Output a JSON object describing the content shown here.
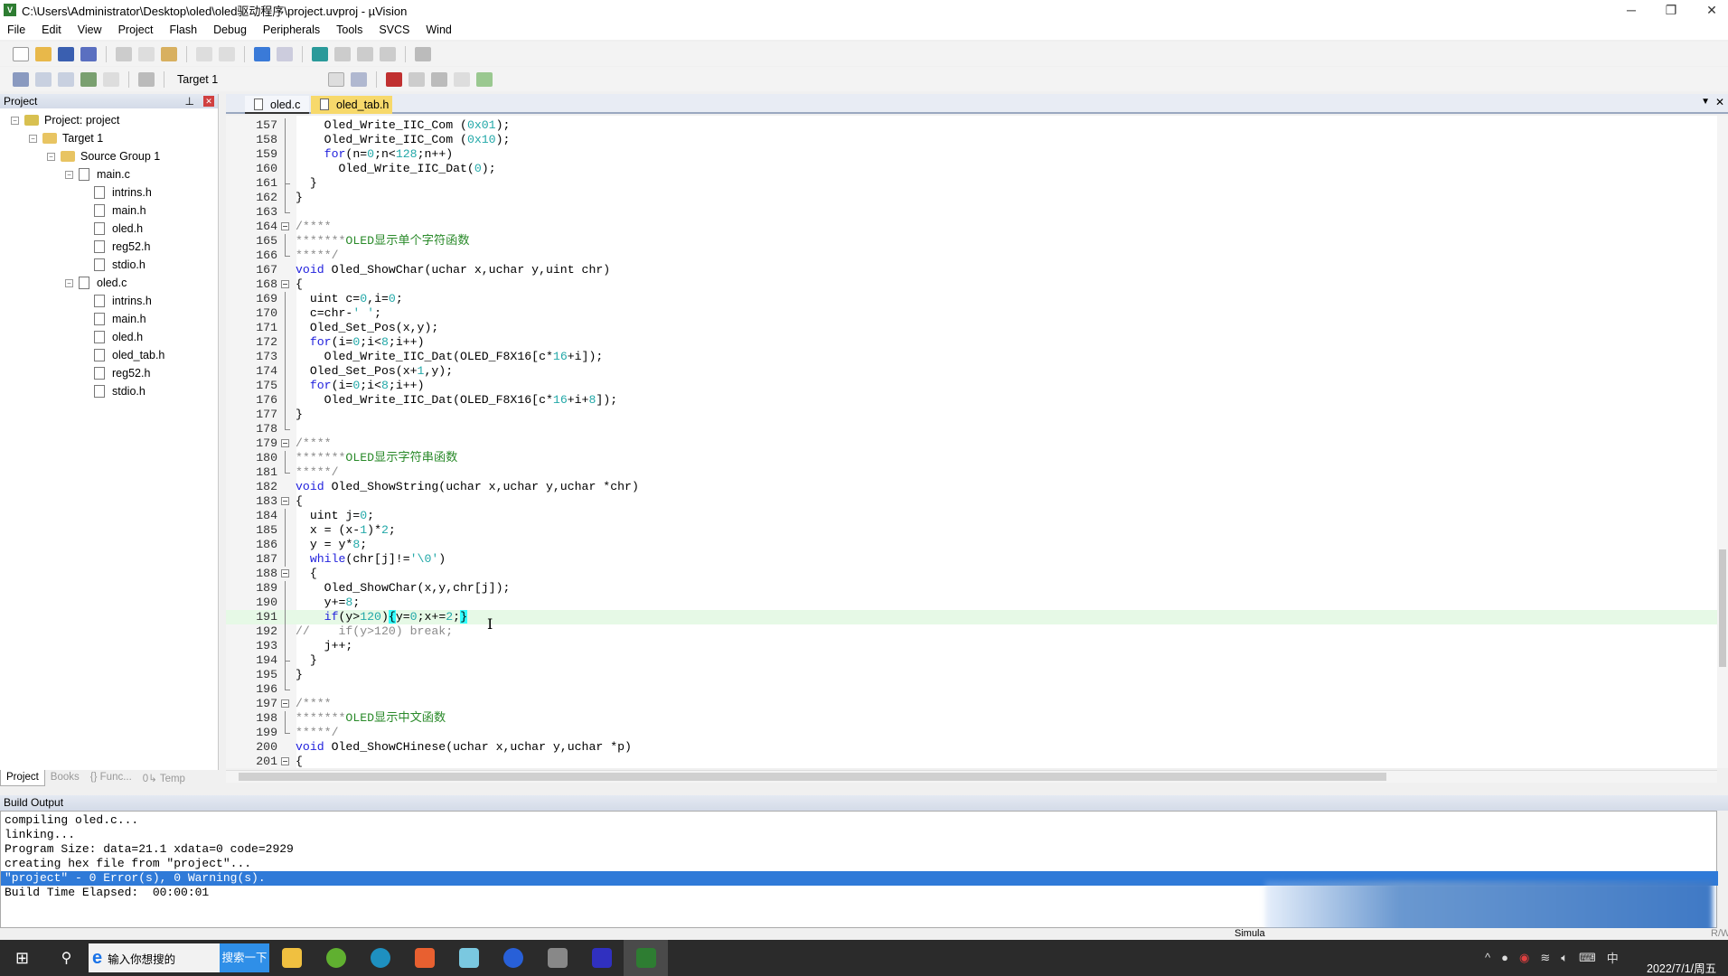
{
  "window": {
    "title": "C:\\Users\\Administrator\\Desktop\\oled\\oled驱动程序\\project.uvproj - µVision",
    "minimize": "─",
    "restore": "❐",
    "close": "✕"
  },
  "menu": [
    "File",
    "Edit",
    "View",
    "Project",
    "Flash",
    "Debug",
    "Peripherals",
    "Tools",
    "SVCS",
    "Wind"
  ],
  "toolbar": {
    "target": "Target 1"
  },
  "project_panel": {
    "title": "Project",
    "tree": [
      {
        "label": "Project: project",
        "level": 0,
        "kind": "project",
        "expanded": true
      },
      {
        "label": "Target 1",
        "level": 1,
        "kind": "target",
        "expanded": true
      },
      {
        "label": "Source Group 1",
        "level": 2,
        "kind": "folder",
        "expanded": true
      },
      {
        "label": "main.c",
        "level": 3,
        "kind": "source",
        "expanded": true
      },
      {
        "label": "intrins.h",
        "level": 4,
        "kind": "file"
      },
      {
        "label": "main.h",
        "level": 4,
        "kind": "file"
      },
      {
        "label": "oled.h",
        "level": 4,
        "kind": "file"
      },
      {
        "label": "reg52.h",
        "level": 4,
        "kind": "file"
      },
      {
        "label": "stdio.h",
        "level": 4,
        "kind": "file"
      },
      {
        "label": "oled.c",
        "level": 3,
        "kind": "source",
        "expanded": true
      },
      {
        "label": "intrins.h",
        "level": 4,
        "kind": "file"
      },
      {
        "label": "main.h",
        "level": 4,
        "kind": "file"
      },
      {
        "label": "oled.h",
        "level": 4,
        "kind": "file"
      },
      {
        "label": "oled_tab.h",
        "level": 4,
        "kind": "file"
      },
      {
        "label": "reg52.h",
        "level": 4,
        "kind": "file"
      },
      {
        "label": "stdio.h",
        "level": 4,
        "kind": "file"
      }
    ],
    "bottom_tabs": [
      {
        "label": "Project",
        "active": true
      },
      {
        "label": "Books"
      },
      {
        "label": "{} Func..."
      },
      {
        "label": "0↳ Temp"
      }
    ]
  },
  "editor": {
    "tabs": [
      {
        "label": "oled.c",
        "active": true
      },
      {
        "label": "oled_tab.h",
        "active": false
      }
    ],
    "lines": [
      {
        "n": 157,
        "text": "    Oled_Write_IIC_Com (0x01);",
        "fold": "line"
      },
      {
        "n": 158,
        "text": "    Oled_Write_IIC_Com (0x10);",
        "fold": "line"
      },
      {
        "n": 159,
        "text": "    for(n=0;n<128;n++)",
        "fold": "line"
      },
      {
        "n": 160,
        "text": "      Oled_Write_IIC_Dat(0);",
        "fold": "line"
      },
      {
        "n": 161,
        "text": "  }",
        "fold": "mid"
      },
      {
        "n": 162,
        "text": "}",
        "fold": "line"
      },
      {
        "n": 163,
        "text": "",
        "fold": "end"
      },
      {
        "n": 164,
        "text": "/****",
        "fold": "open"
      },
      {
        "n": 165,
        "text": "*******OLED显示单个字符函数",
        "fold": "line"
      },
      {
        "n": 166,
        "text": "*****/",
        "fold": "end"
      },
      {
        "n": 167,
        "text": "void Oled_ShowChar(uchar x,uchar y,uint chr)",
        "fold": ""
      },
      {
        "n": 168,
        "text": "{",
        "fold": "open"
      },
      {
        "n": 169,
        "text": "  uint c=0,i=0;",
        "fold": "line"
      },
      {
        "n": 170,
        "text": "  c=chr-' ';",
        "fold": "line"
      },
      {
        "n": 171,
        "text": "  Oled_Set_Pos(x,y);",
        "fold": "line"
      },
      {
        "n": 172,
        "text": "  for(i=0;i<8;i++)",
        "fold": "line"
      },
      {
        "n": 173,
        "text": "    Oled_Write_IIC_Dat(OLED_F8X16[c*16+i]);",
        "fold": "line"
      },
      {
        "n": 174,
        "text": "  Oled_Set_Pos(x+1,y);",
        "fold": "line"
      },
      {
        "n": 175,
        "text": "  for(i=0;i<8;i++)",
        "fold": "line"
      },
      {
        "n": 176,
        "text": "    Oled_Write_IIC_Dat(OLED_F8X16[c*16+i+8]);",
        "fold": "line"
      },
      {
        "n": 177,
        "text": "}",
        "fold": "line"
      },
      {
        "n": 178,
        "text": "",
        "fold": "end"
      },
      {
        "n": 179,
        "text": "/****",
        "fold": "open"
      },
      {
        "n": 180,
        "text": "*******OLED显示字符串函数",
        "fold": "line"
      },
      {
        "n": 181,
        "text": "*****/",
        "fold": "end"
      },
      {
        "n": 182,
        "text": "void Oled_ShowString(uchar x,uchar y,uchar *chr)",
        "fold": ""
      },
      {
        "n": 183,
        "text": "{",
        "fold": "open"
      },
      {
        "n": 184,
        "text": "  uint j=0;",
        "fold": "line"
      },
      {
        "n": 185,
        "text": "  x = (x-1)*2;",
        "fold": "line"
      },
      {
        "n": 186,
        "text": "  y = y*8;",
        "fold": "line"
      },
      {
        "n": 187,
        "text": "  while(chr[j]!='\\0')",
        "fold": "line"
      },
      {
        "n": 188,
        "text": "  {",
        "fold": "open"
      },
      {
        "n": 189,
        "text": "    Oled_ShowChar(x,y,chr[j]);",
        "fold": "line"
      },
      {
        "n": 190,
        "text": "    y+=8;",
        "fold": "line"
      },
      {
        "n": 191,
        "text": "    if(y>120){y=0;x+=2;}",
        "fold": "line",
        "current": true
      },
      {
        "n": 192,
        "text": "//    if(y>120) break;",
        "fold": "line"
      },
      {
        "n": 193,
        "text": "    j++;",
        "fold": "line"
      },
      {
        "n": 194,
        "text": "  }",
        "fold": "mid"
      },
      {
        "n": 195,
        "text": "}",
        "fold": "line"
      },
      {
        "n": 196,
        "text": "",
        "fold": "end"
      },
      {
        "n": 197,
        "text": "/****",
        "fold": "open"
      },
      {
        "n": 198,
        "text": "*******OLED显示中文函数",
        "fold": "line"
      },
      {
        "n": 199,
        "text": "*****/",
        "fold": "end"
      },
      {
        "n": 200,
        "text": "void Oled_ShowCHinese(uchar x,uchar y,uchar *p)",
        "fold": ""
      },
      {
        "n": 201,
        "text": "{",
        "fold": "open"
      }
    ]
  },
  "build_output": {
    "title": "Build Output",
    "lines": [
      {
        "text": "compiling oled.c..."
      },
      {
        "text": "linking..."
      },
      {
        "text": "Program Size: data=21.1 xdata=0 code=2929"
      },
      {
        "text": "creating hex file from \"project\"..."
      },
      {
        "text": "\"project\" - 0 Error(s), 0 Warning(s).",
        "selected": true
      },
      {
        "text": "Build Time Elapsed:  00:00:01"
      }
    ]
  },
  "statusbar": {
    "mode": "Simula",
    "rw": "R/W"
  },
  "taskbar": {
    "search_placeholder": "输入你想搜的",
    "search_button": "搜索一下",
    "ime": "中",
    "datetime": "2022/7/1/周五"
  },
  "colors": {
    "keyword": "#2222dd",
    "number": "#22a8a8",
    "comment": "#2a8a2a",
    "selection": "#2f7ad8",
    "current_line": "#e6f9e6",
    "active_tab": "#f7d96b"
  }
}
